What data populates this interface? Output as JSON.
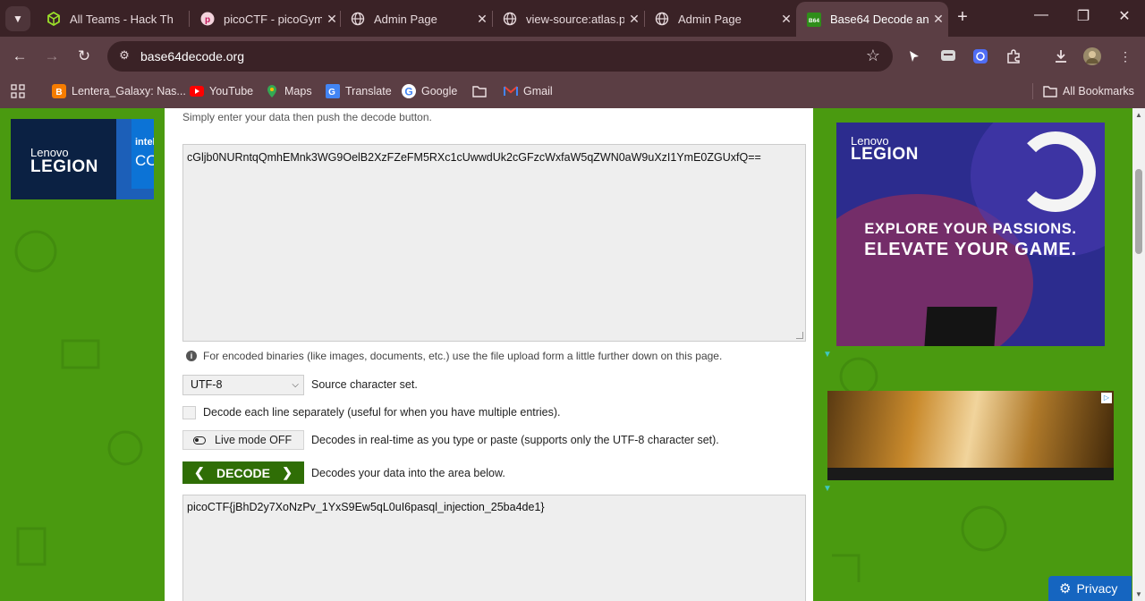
{
  "tabs": [
    {
      "title": "All Teams - Hack Th",
      "active": false
    },
    {
      "title": "picoCTF - picoGym",
      "active": false
    },
    {
      "title": "Admin Page",
      "active": false
    },
    {
      "title": "view-source:atlas.p",
      "active": false
    },
    {
      "title": "Admin Page",
      "active": false
    },
    {
      "title": "Base64 Decode an",
      "active": true
    }
  ],
  "omnibox": {
    "url": "base64decode.org"
  },
  "bookmarks": [
    {
      "label": "Lentera_Galaxy: Nas..."
    },
    {
      "label": "YouTube"
    },
    {
      "label": "Maps"
    },
    {
      "label": "Translate"
    },
    {
      "label": "Google"
    },
    {
      "label": ""
    },
    {
      "label": "Gmail"
    }
  ],
  "all_bookmarks": "All Bookmarks",
  "page": {
    "intro": "Simply enter your data then push the decode button.",
    "input_value": "cGljb0NURntqQmhEMnk3WG9OelB2XzFZeFM5RXc1cUwwdUk2cGFzcWxfaW5qZWN0aW9uXzI1YmE0ZGUxfQ==",
    "binary_note": "For encoded binaries (like images, documents, etc.) use the file upload form a little further down on this page.",
    "charset_value": "UTF-8",
    "charset_label": "Source character set.",
    "each_line_label": "Decode each line separately (useful for when you have multiple entries).",
    "live_mode_label": "Live mode OFF",
    "live_mode_desc": "Decodes in real-time as you type or paste (supports only the UTF-8 character set).",
    "decode_label": "DECODE",
    "decode_desc": "Decodes your data into the area below.",
    "output_value": "picoCTF{jBhD2y7XoNzPv_1YxS9Ew5qL0uI6pasql_injection_25ba4de1}"
  },
  "ads": {
    "left": {
      "brand": "Lenovo",
      "product": "LEGION",
      "partner": "intel",
      "partner_sub": "CO"
    },
    "right": {
      "brand": "Lenovo",
      "product": "LEGION",
      "line1": "EXPLORE YOUR PASSIONS.",
      "line2": "ELEVATE YOUR GAME."
    }
  },
  "privacy_label": "Privacy",
  "colors": {
    "page_green": "#4a9a10",
    "decode_button": "#2f6e06",
    "chrome": "#5b3e44",
    "privacy": "#1565c0"
  }
}
